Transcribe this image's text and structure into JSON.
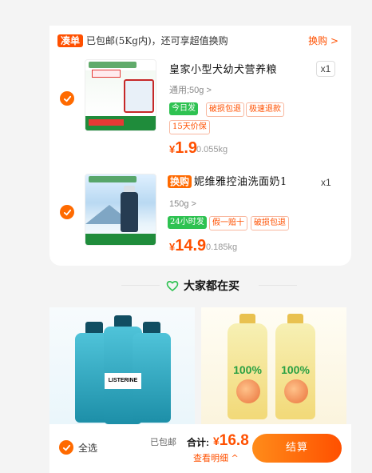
{
  "promo": {
    "tag": "凑单",
    "text": "已包邮(5Kg内)，还可享超值换购",
    "link": "换购 >"
  },
  "items": [
    {
      "name": "皇家小型犬幼犬营养粮",
      "spec": "通用;50g >",
      "tags": [
        "今日发",
        "破损包退",
        "极速退款",
        "15天价保"
      ],
      "price_currency": "¥",
      "price": "1.9",
      "weight": "0.055kg",
      "quantity": "x1"
    },
    {
      "badge": "换购",
      "name": "妮维雅控油洗面奶1",
      "spec": "150g >",
      "tags": [
        "24小时发",
        "假一赔十",
        "破损包退"
      ],
      "price_currency": "¥",
      "price": "14.9",
      "weight": "0.185kg",
      "quantity": "x1"
    }
  ],
  "recommend": {
    "title": "大家都在买",
    "products": [
      {
        "image_text": "LISTERINE"
      },
      {
        "image_text": "100%"
      }
    ]
  },
  "bottom": {
    "select_all": "全选",
    "ship_note": "已包邮",
    "total_label": "合计:",
    "total_currency": "¥",
    "total": "16.8",
    "detail_link": "查看明细 ^",
    "checkout": "结算"
  },
  "colors": {
    "accent": "#ff5000",
    "green_tag": "#2ec251"
  },
  "icons": [
    "check-icon",
    "heart-icon",
    "chevron-right-icon"
  ]
}
